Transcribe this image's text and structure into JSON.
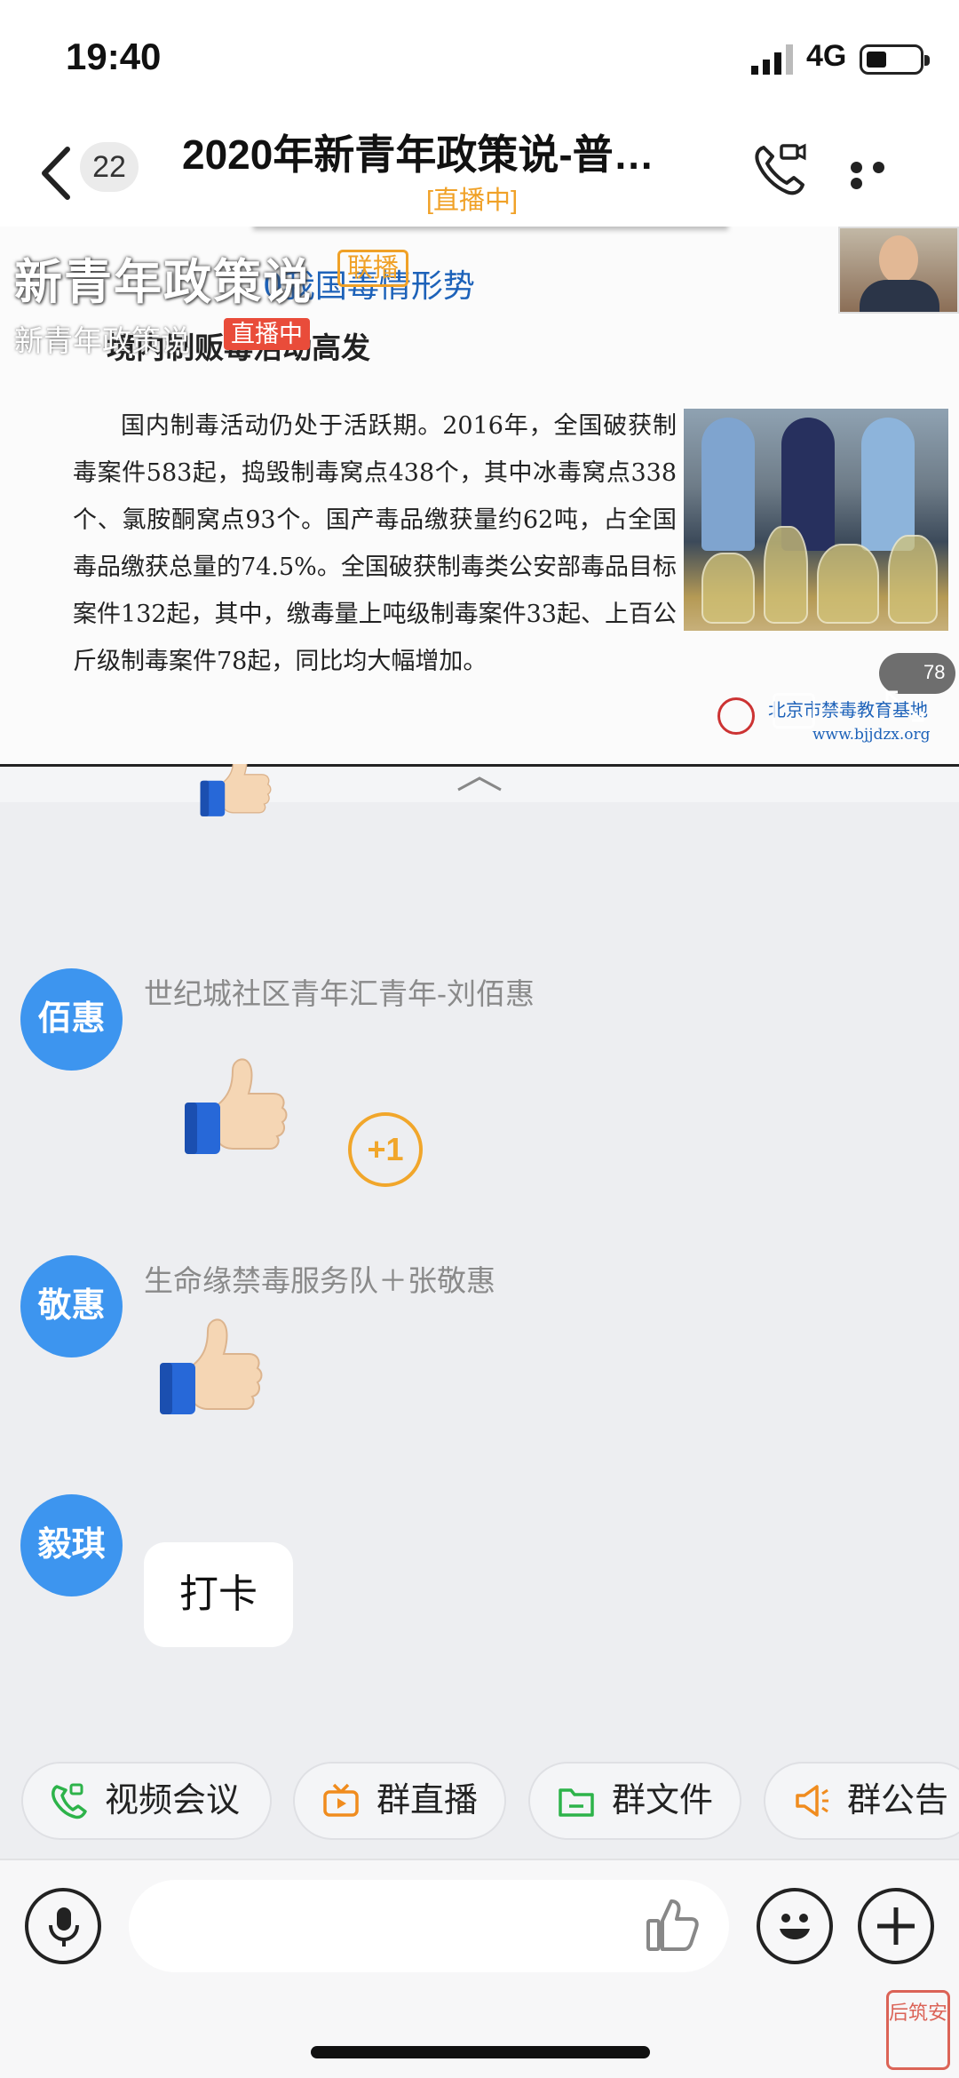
{
  "status_bar": {
    "time": "19:40",
    "network": "4G"
  },
  "header": {
    "unread_count": "22",
    "title": "2020年新青年政策说-普…",
    "live_status": "[直播中]"
  },
  "live_overlay": {
    "channel_name": "新青年政策说",
    "channel_sub": "新青年政策说",
    "live_tag": "直播中",
    "lianbo_tag": "联播"
  },
  "slide": {
    "heading": "0我国毒情形势",
    "subheading": "境内制贩毒活动高发",
    "body": "国内制毒活动仍处于活跃期。2016年，全国破获制毒案件583起，捣毁制毒窝点438个，其中冰毒窝点338个、氯胺酮窝点93个。国产毒品缴获量约62吨，占全国毒品缴获总量的74.5%。全国破获制毒类公安部毒品目标案件132起，其中，缴毒量上吨级制毒案件33起、上百公斤级制毒案件78起，同比均大幅增加。",
    "footer_org": "北京市禁毒教育基地",
    "footer_url": "www.bjjdzx.org",
    "mini_counter": "78"
  },
  "messages": [
    {
      "avatar": "佰惠",
      "sender": "世纪城社区青年汇青年-刘佰惠",
      "content": "thumbs-up",
      "extra": "+1"
    },
    {
      "avatar": "敬惠",
      "sender": "生命缘禁毒服务队＋张敬惠",
      "content": "thumbs-up"
    },
    {
      "avatar": "毅琪",
      "sender": "",
      "content": "打卡"
    }
  ],
  "quick_actions": [
    {
      "label": "视频会议",
      "icon": "video-phone-icon",
      "color": "#2db34a"
    },
    {
      "label": "群直播",
      "icon": "tv-icon",
      "color": "#f08c1e"
    },
    {
      "label": "群文件",
      "icon": "folder-icon",
      "color": "#2db34a"
    },
    {
      "label": "群公告",
      "icon": "megaphone-icon",
      "color": "#f08c1e"
    }
  ],
  "watermark": "后筑安"
}
